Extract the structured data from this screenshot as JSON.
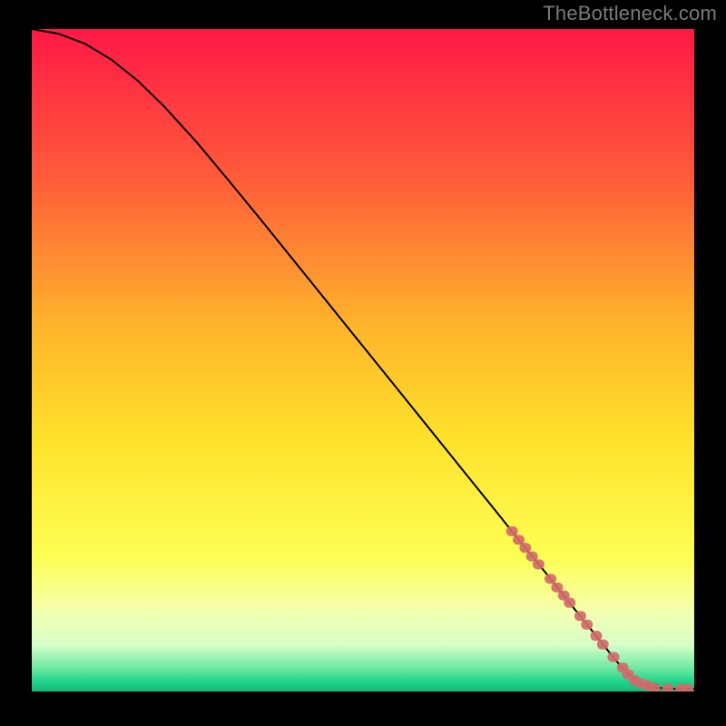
{
  "attribution": "TheBottleneck.com",
  "colors": {
    "bg": "#000000",
    "attribution_text": "#7a7a7a",
    "curve": "#000000",
    "marker_fill": "#d46a6a",
    "marker_stroke": "#d46a6a",
    "gradient_stops": [
      {
        "offset": 0.0,
        "color": "#ff1846"
      },
      {
        "offset": 0.22,
        "color": "#ff5a3a"
      },
      {
        "offset": 0.45,
        "color": "#ffb52b"
      },
      {
        "offset": 0.62,
        "color": "#ffe22b"
      },
      {
        "offset": 0.8,
        "color": "#fdff55"
      },
      {
        "offset": 0.88,
        "color": "#f4ffb0"
      },
      {
        "offset": 0.93,
        "color": "#d6ffc8"
      },
      {
        "offset": 0.965,
        "color": "#6fe8a3"
      },
      {
        "offset": 0.985,
        "color": "#1fd48c"
      },
      {
        "offset": 1.0,
        "color": "#17b877"
      }
    ]
  },
  "chart_data": {
    "type": "line",
    "title": "",
    "xlabel": "",
    "ylabel": "",
    "xlim": [
      0,
      100
    ],
    "ylim": [
      0,
      100
    ],
    "grid": false,
    "legend": false,
    "series": [
      {
        "name": "bottleneck-curve",
        "x": [
          0,
          4,
          8,
          12,
          16,
          20,
          25,
          30,
          35,
          40,
          45,
          50,
          55,
          60,
          65,
          70,
          74,
          78,
          81,
          84,
          86,
          88,
          90,
          92,
          94,
          96,
          98,
          100
        ],
        "y": [
          100,
          99.3,
          97.8,
          95.4,
          92.2,
          88.3,
          82.8,
          76.8,
          70.7,
          64.5,
          58.3,
          52.1,
          45.9,
          39.7,
          33.5,
          27.3,
          22.3,
          17.4,
          13.6,
          9.9,
          7.4,
          4.9,
          2.6,
          1.2,
          0.6,
          0.45,
          0.4,
          0.4
        ]
      }
    ],
    "markers": {
      "name": "highlighted-points",
      "points": [
        {
          "x": 72.5,
          "y": 24.2
        },
        {
          "x": 73.5,
          "y": 22.9
        },
        {
          "x": 74.5,
          "y": 21.7
        },
        {
          "x": 75.5,
          "y": 20.4
        },
        {
          "x": 76.5,
          "y": 19.2
        },
        {
          "x": 78.3,
          "y": 17.0
        },
        {
          "x": 79.3,
          "y": 15.7
        },
        {
          "x": 80.3,
          "y": 14.5
        },
        {
          "x": 81.2,
          "y": 13.4
        },
        {
          "x": 82.8,
          "y": 11.4
        },
        {
          "x": 83.8,
          "y": 10.1
        },
        {
          "x": 85.2,
          "y": 8.4
        },
        {
          "x": 86.2,
          "y": 7.1
        },
        {
          "x": 87.8,
          "y": 5.2
        },
        {
          "x": 89.2,
          "y": 3.6
        },
        {
          "x": 90.0,
          "y": 2.6
        },
        {
          "x": 91.0,
          "y": 1.7
        },
        {
          "x": 92.0,
          "y": 1.2
        },
        {
          "x": 93.0,
          "y": 0.9
        },
        {
          "x": 94.0,
          "y": 0.55
        },
        {
          "x": 96.0,
          "y": 0.45
        },
        {
          "x": 98.0,
          "y": 0.4
        },
        {
          "x": 99.0,
          "y": 0.4
        }
      ]
    }
  }
}
